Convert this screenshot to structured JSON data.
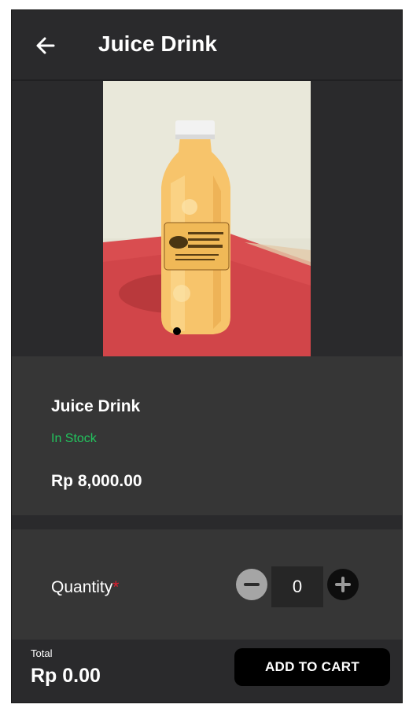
{
  "header": {
    "title": "Juice Drink",
    "back_icon": "arrow-left-icon"
  },
  "product": {
    "name": "Juice Drink",
    "stock_status": "In Stock",
    "price": "Rp 8,000.00",
    "image": "juice-bottle-photo"
  },
  "quantity": {
    "label": "Quantity",
    "required_marker": "*",
    "value": "0"
  },
  "footer": {
    "total_label": "Total",
    "total_value": "Rp 0.00",
    "add_to_cart_label": "ADD TO CART"
  },
  "colors": {
    "background": "#2b2b2b",
    "card": "#363636",
    "in_stock": "#22c55e",
    "required": "#e11d2e",
    "button": "#000000"
  }
}
